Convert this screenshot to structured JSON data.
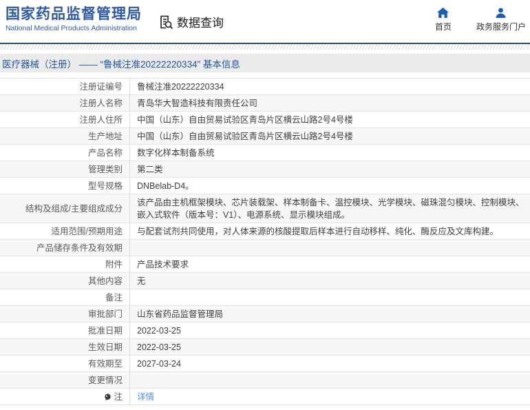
{
  "header": {
    "title": "国家药品监督管理局",
    "subtitle": "National Medical Products Administration",
    "section": "数据查询",
    "nav": [
      {
        "label": "首页",
        "icon": "home-icon"
      },
      {
        "label": "政务服务门户",
        "icon": "user-icon"
      }
    ]
  },
  "breadcrumb": "医疗器械（注册） —— “鲁械注准20222220334” 基本信息",
  "table": {
    "rows": [
      {
        "label": "注册证编号",
        "value": "鲁械注准20222220334"
      },
      {
        "label": "注册人名称",
        "value": "青岛华大智造科技有限责任公司"
      },
      {
        "label": "注册人住所",
        "value": "中国（山东）自由贸易试验区青岛片区横云山路2号4号楼"
      },
      {
        "label": "生产地址",
        "value": "中国（山东）自由贸易试验区青岛片区横云山路2号4号楼"
      },
      {
        "label": "产品名称",
        "value": "数字化样本制备系统"
      },
      {
        "label": "管理类别",
        "value": "第二类"
      },
      {
        "label": "型号规格",
        "value": "DNBelab-D4。"
      },
      {
        "label": "结构及组成/主要组成成分",
        "value": "该产品由主机框架模块、芯片装载架、样本制备卡、温控模块、光学模块、磁珠混匀模块、控制模块、嵌入式软件（版本号：V1）、电源系统、显示模块组成。"
      },
      {
        "label": "适用范围/预期用途",
        "value": "与配套试剂共同使用，对人体来源的核酸提取后样本进行自动移样、纯化、酶反应及文库构建。"
      },
      {
        "label": "产品储存条件及有效期",
        "value": ""
      },
      {
        "label": "附件",
        "value": "产品技术要求"
      },
      {
        "label": "其他内容",
        "value": "无"
      },
      {
        "label": "备注",
        "value": ""
      },
      {
        "label": "审批部门",
        "value": "山东省药品监督管理局"
      },
      {
        "label": "批准日期",
        "value": "2022-03-25"
      },
      {
        "label": "生效日期",
        "value": "2022-03-25"
      },
      {
        "label": "有效期至",
        "value": "2027-03-24"
      },
      {
        "label": "变更情况",
        "value": ""
      },
      {
        "label": "注",
        "value": "详情",
        "link": true,
        "icon": "note-icon"
      }
    ]
  },
  "colors": {
    "brand_blue": "#2e59a7",
    "icon_blue": "#1d5cb0",
    "header_rule": "#29506b",
    "breadcrumb_bg": "#ebebeb",
    "breadcrumb_text": "#2456a5",
    "row_alt_bg": "#f7f7f7",
    "link_blue": "#4a90e2"
  }
}
